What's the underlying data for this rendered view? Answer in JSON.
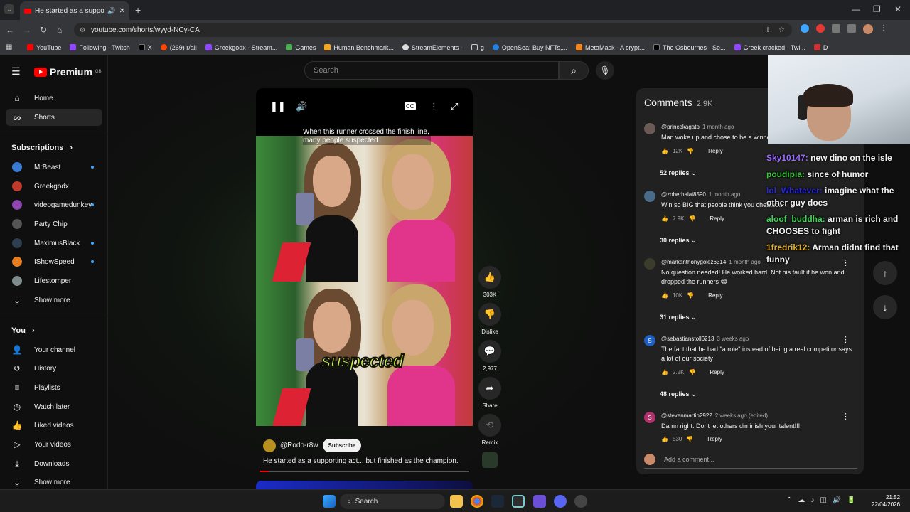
{
  "browser": {
    "tab_title": "He started as a supporting",
    "url": "youtube.com/shorts/wyyd-NCy-CA",
    "bookmarks": [
      "YouTube",
      "Following - Twitch",
      "X",
      "(269) r/all",
      "Greekgodx - Stream...",
      "Games",
      "Human Benchmark...",
      "StreamElements -",
      "g",
      "OpenSea: Buy NFTs,...",
      "MetaMask - A crypt...",
      "The Osbournes - Se...",
      "Greek cracked - Twi...",
      "D"
    ]
  },
  "youtube": {
    "logo": "Premium",
    "region": "GB",
    "search_placeholder": "Search"
  },
  "sidebar": {
    "main": [
      {
        "label": "Home"
      },
      {
        "label": "Shorts"
      }
    ],
    "subscriptions_title": "Subscriptions",
    "subscriptions": [
      {
        "label": "MrBeast",
        "color": "#3a7bd5",
        "dot": true
      },
      {
        "label": "Greekgodx",
        "color": "#c0392b",
        "dot": false
      },
      {
        "label": "videogamedunkey",
        "color": "#8e44ad",
        "dot": true
      },
      {
        "label": "Party Chip",
        "color": "#555555",
        "dot": false
      },
      {
        "label": "MaximusBlack",
        "color": "#2c3e50",
        "dot": true
      },
      {
        "label": "IShowSpeed",
        "color": "#e67e22",
        "dot": true
      },
      {
        "label": "Lifestomper",
        "color": "#7f8c8d",
        "dot": false
      }
    ],
    "show_more": "Show more",
    "you_title": "You",
    "you": [
      {
        "label": "Your channel"
      },
      {
        "label": "History"
      },
      {
        "label": "Playlists"
      },
      {
        "label": "Watch later"
      },
      {
        "label": "Liked videos"
      },
      {
        "label": "Your videos"
      },
      {
        "label": "Downloads"
      }
    ],
    "show_more_2": "Show more"
  },
  "video": {
    "caption": "When this runner crossed the finish line, many people suspected",
    "overlay_word": "suspected",
    "channel": "@Rodo-r8w",
    "subscribe": "Subscribe",
    "description": "He started as a supporting act... but finished as the champion.",
    "progress": 0.04
  },
  "actions": {
    "likes": "303K",
    "dislike": "Dislike",
    "comments": "2,977",
    "share": "Share",
    "remix": "Remix"
  },
  "comments_panel": {
    "title": "Comments",
    "count": "2.9K",
    "add_placeholder": "Add a comment...",
    "items": [
      {
        "user": "@princekagato",
        "time": "1 month ago",
        "text": "Man woke up and chose to be a winner",
        "likes": "12K",
        "reply": "Reply",
        "replies": "52 replies",
        "avatar": "#6a5a55"
      },
      {
        "user": "@zoherhalai8590",
        "time": "1 month ago",
        "text": "Win so BIG that people think you cheated!!",
        "likes": "7.9K",
        "reply": "Reply",
        "replies": "30 replies",
        "avatar": "#4a6a8a"
      },
      {
        "user": "@markanthonygolez6314",
        "time": "1 month ago",
        "text": "No question needed! He worked hard. Not his fault if he won and dropped the runners 😁",
        "likes": "10K",
        "reply": "Reply",
        "replies": "31 replies",
        "avatar": "#3c3c2c"
      },
      {
        "user": "@sebastianstoll6213",
        "time": "3 weeks ago",
        "text": "The fact that he had \"a role\" instead of being a real competitor says a lot of our society",
        "likes": "2.2K",
        "reply": "Reply",
        "replies": "48 replies",
        "avatar": "#1f5fbf",
        "initial": "S"
      },
      {
        "user": "@stevenmartin2922",
        "time": "2 weeks ago (edited)",
        "text": "Damn right. Dont let others diminish your talent!!!",
        "likes": "530",
        "reply": "Reply",
        "replies": "",
        "avatar": "#b0306a",
        "initial": "S"
      }
    ]
  },
  "chat": [
    {
      "user": "Sky10147:",
      "msg": "new dino on the isle",
      "color": "#9b6bff"
    },
    {
      "user": "poudipia:",
      "msg": "since of humor",
      "color": "#3cc43c"
    },
    {
      "user": "lol_Whatever:",
      "msg": "imagine what the other guy does",
      "color": "#2a2ad0"
    },
    {
      "user": "aloof_buddha:",
      "msg": "arman is rich and CHOOSES to fight",
      "color": "#44d35a"
    },
    {
      "user": "1fredrik12:",
      "msg": "Arman didnt find that funny",
      "color": "#e0b030"
    }
  ],
  "taskbar": {
    "search": "Search",
    "time": "21:52",
    "date": "22/04/2026"
  }
}
